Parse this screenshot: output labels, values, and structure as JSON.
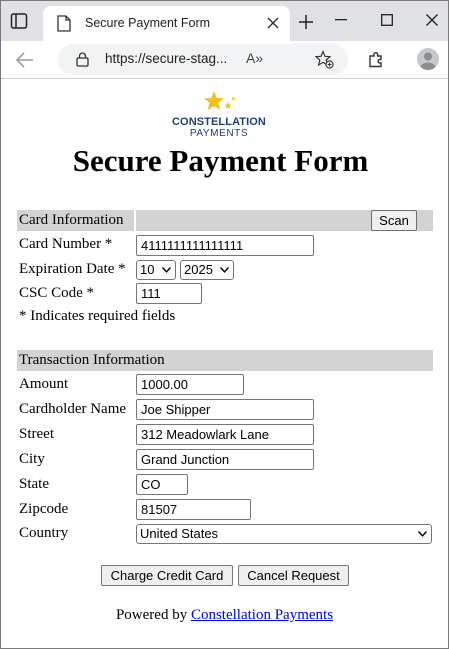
{
  "browser": {
    "tab_title": "Secure Payment Form",
    "url": "https://secure-stag...",
    "read_aloud": "A»"
  },
  "logo": {
    "brand": "CONSTELLATION",
    "sub": "PAYMENTS"
  },
  "page": {
    "title": "Secure Payment Form"
  },
  "card": {
    "section_label": "Card Information",
    "scan_label": "Scan",
    "card_number_label": "Card Number *",
    "card_number_value": "4111111111111111",
    "expiration_label": "Expiration Date *",
    "exp_month": "10",
    "exp_year": "2025",
    "csc_label": "CSC Code *",
    "csc_value": "111",
    "required_note": "* Indicates required fields"
  },
  "transaction": {
    "section_label": "Transaction Information",
    "amount_label": "Amount",
    "amount_value": "1000.00",
    "cardholder_label": "Cardholder Name",
    "cardholder_value": "Joe Shipper",
    "street_label": "Street",
    "street_value": "312 Meadowlark Lane",
    "city_label": "City",
    "city_value": "Grand Junction",
    "state_label": "State",
    "state_value": "CO",
    "zip_label": "Zipcode",
    "zip_value": "81507",
    "country_label": "Country",
    "country_value": "United States"
  },
  "actions": {
    "charge_label": "Charge Credit Card",
    "cancel_label": "Cancel Request"
  },
  "footer": {
    "prefix": "Powered by",
    "link_text": "Constellation Payments"
  },
  "colors": {
    "section_bar": "#d3d3d3",
    "link": "#0000ee",
    "brand": "#1f3f73",
    "star": "#f2c21b"
  }
}
